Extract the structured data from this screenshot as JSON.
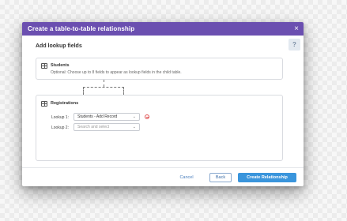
{
  "colors": {
    "accent": "#6b4fb0",
    "primary": "#3a95dc"
  },
  "dialog": {
    "title": "Create a table-to-table relationship",
    "close_icon": "×",
    "help_icon": "?",
    "section_title": "Add lookup fields"
  },
  "students": {
    "name": "Students",
    "description": "Optional: Choose up to 8 fields to appear as lookup fields in the child table."
  },
  "registrations": {
    "name": "Registrations",
    "lookups": [
      {
        "label": "Lookup 1:",
        "value": "Students - Add Record",
        "placeholder": ""
      },
      {
        "label": "Lookup 2:",
        "value": "",
        "placeholder": "Search and select"
      }
    ]
  },
  "footer": {
    "cancel_label": "Cancel",
    "back_label": "Back",
    "create_label": "Create Relationship"
  },
  "icons": {
    "chevron": "⌄"
  }
}
